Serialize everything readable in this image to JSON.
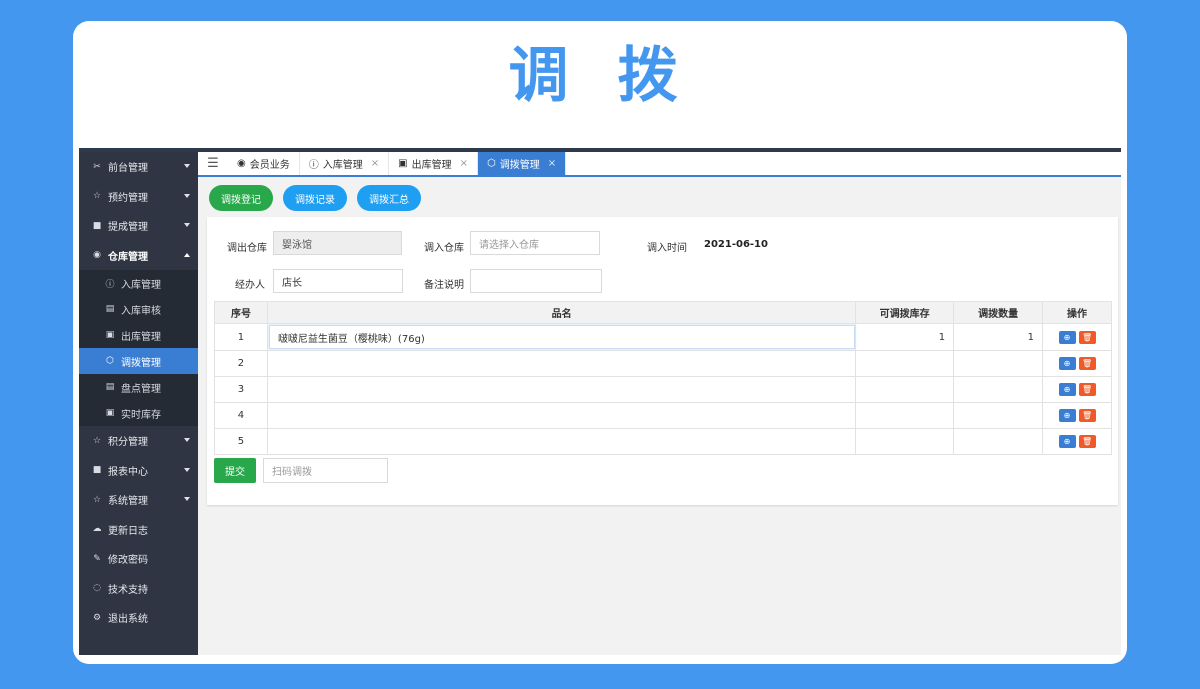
{
  "hero": {
    "title": "调 拨"
  },
  "sidebar": {
    "items": [
      {
        "icon": "✂",
        "label": "前台管理",
        "caret": true
      },
      {
        "icon": "☆",
        "label": "预约管理",
        "caret": true
      },
      {
        "icon": "■",
        "label": "提成管理",
        "caret": true
      },
      {
        "icon": "◉",
        "label": "仓库管理",
        "caret": true,
        "open": true,
        "children": [
          {
            "icon": "ⓘ",
            "label": "入库管理"
          },
          {
            "icon": "▤",
            "label": "入库审核"
          },
          {
            "icon": "▣",
            "label": "出库管理"
          },
          {
            "icon": "⬡",
            "label": "调拨管理",
            "active": true
          },
          {
            "icon": "▤",
            "label": "盘点管理"
          },
          {
            "icon": "▣",
            "label": "实时库存"
          }
        ]
      },
      {
        "icon": "☆",
        "label": "积分管理",
        "caret": true
      },
      {
        "icon": "■",
        "label": "报表中心",
        "caret": true
      },
      {
        "icon": "☆",
        "label": "系统管理",
        "caret": true
      },
      {
        "icon": "☁",
        "label": "更新日志"
      },
      {
        "icon": "✎",
        "label": "修改密码"
      },
      {
        "icon": "◌",
        "label": "技术支持"
      },
      {
        "icon": "⚙",
        "label": "退出系统"
      }
    ]
  },
  "tabs": {
    "toggle_icon": "☰",
    "items": [
      {
        "icon": "◉",
        "label": "会员业务",
        "closable": false
      },
      {
        "icon": "ⓘ",
        "label": "入库管理",
        "closable": true
      },
      {
        "icon": "▣",
        "label": "出库管理",
        "closable": true
      },
      {
        "icon": "⬡",
        "label": "调拨管理",
        "closable": true,
        "active": true
      }
    ],
    "close_glyph": "×"
  },
  "toolbar": {
    "register_label": "调拨登记",
    "records_label": "调拨记录",
    "summary_label": "调拨汇总"
  },
  "form": {
    "out_wh_label": "调出仓库",
    "out_wh_value": "婴泳馆",
    "in_wh_label": "调入仓库",
    "in_wh_placeholder": "请选择入仓库",
    "in_time_label": "调入时间",
    "in_time_value": "2021-06-10",
    "handler_label": "经办人",
    "handler_value": "店长",
    "remark_label": "备注说明",
    "remark_value": ""
  },
  "table": {
    "headers": {
      "idx": "序号",
      "name": "品名",
      "stock": "可调拨库存",
      "qty": "调拨数量",
      "ops": "操作"
    },
    "rows": [
      {
        "idx": "1",
        "name": "啵啵尼益生菌豆（樱桃味）(76g)",
        "stock": "1",
        "qty": "1"
      },
      {
        "idx": "2",
        "name": "",
        "stock": "",
        "qty": ""
      },
      {
        "idx": "3",
        "name": "",
        "stock": "",
        "qty": ""
      },
      {
        "idx": "4",
        "name": "",
        "stock": "",
        "qty": ""
      },
      {
        "idx": "5",
        "name": "",
        "stock": "",
        "qty": ""
      }
    ],
    "add_icon": "⊕",
    "delete_icon": "🗑"
  },
  "footer": {
    "submit_label": "提交",
    "scan_placeholder": "扫码调拨"
  },
  "colors": {
    "accent": "#3a7ed4",
    "page_bg": "#4397ee",
    "green": "#29a84b",
    "danger": "#f05a28",
    "sidebar": "#2f3542"
  }
}
